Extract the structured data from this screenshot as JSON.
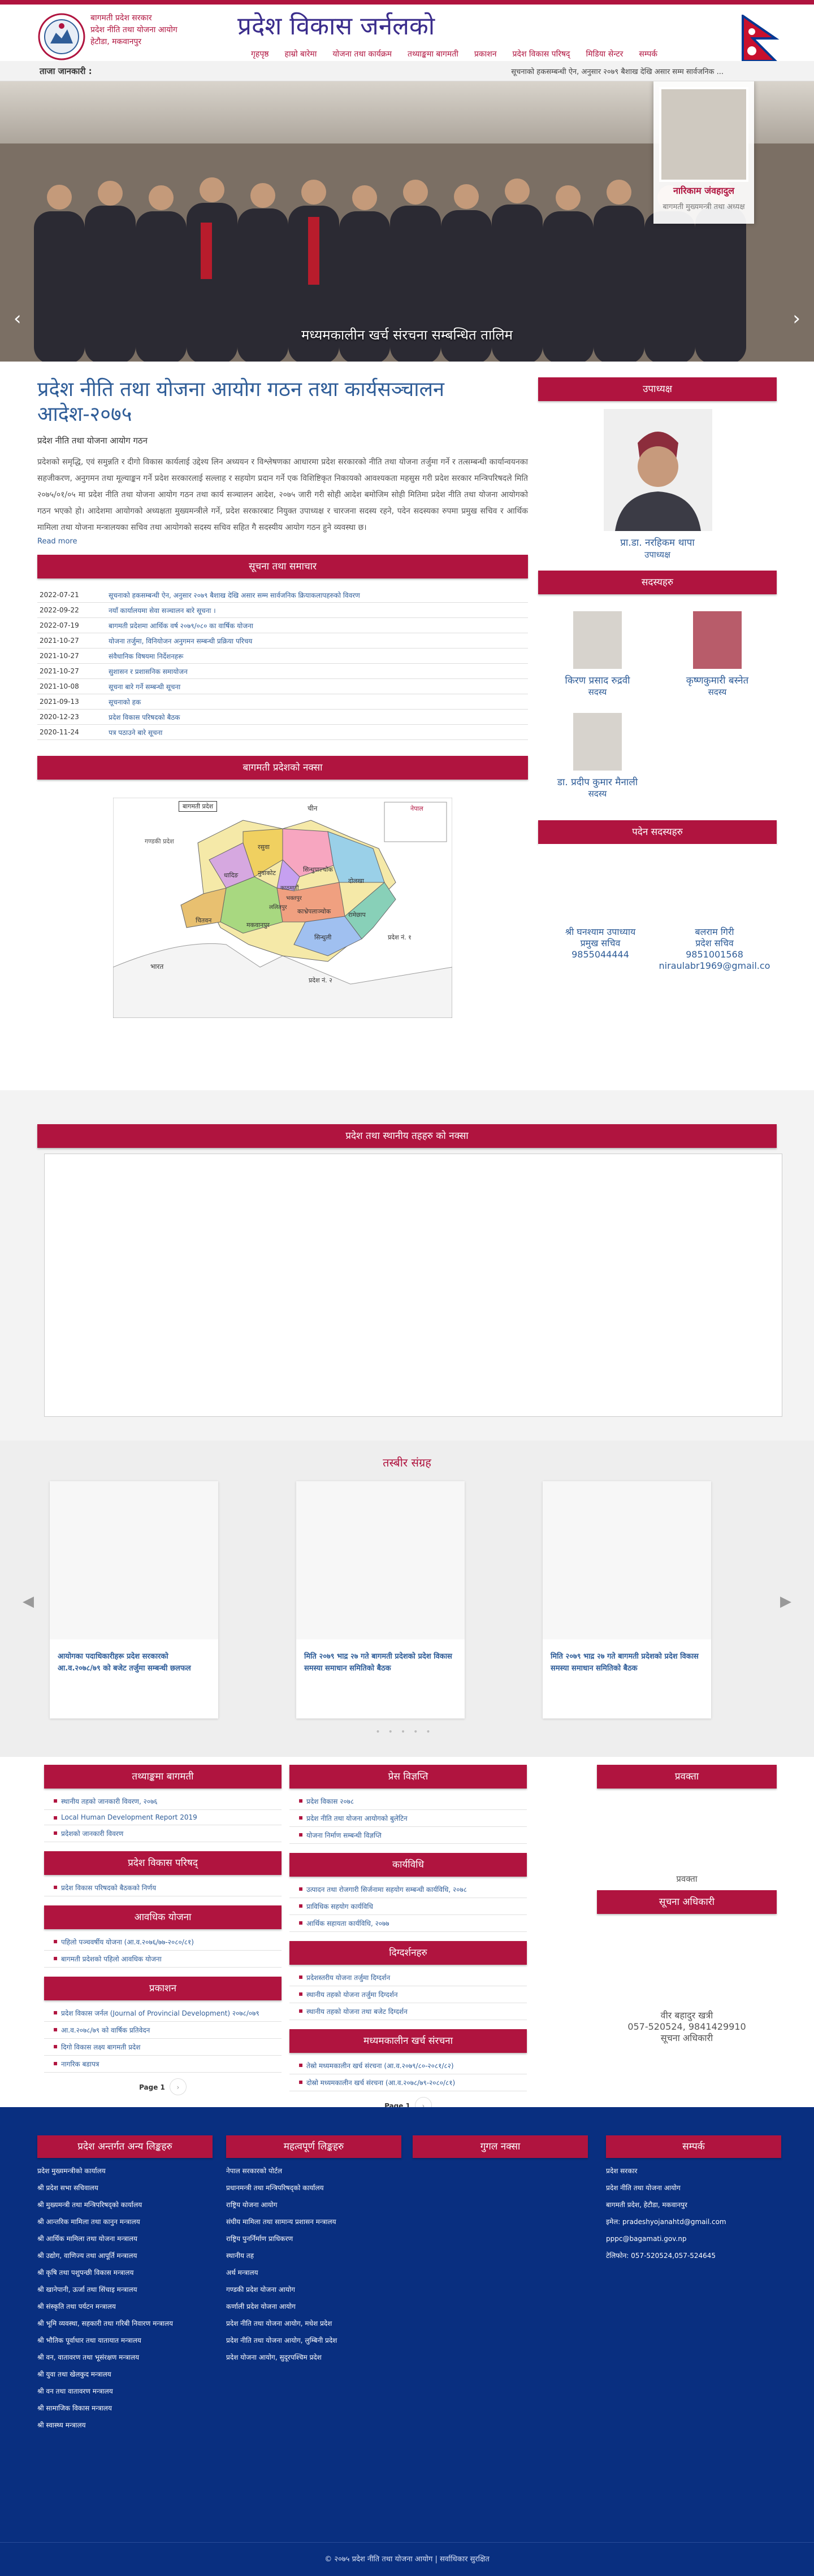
{
  "header": {
    "org_lines": [
      "बागमती प्रदेश सरकार",
      "प्रदेश नीति तथा योजना आयोग",
      "हेटौडा, मकवानपुर"
    ],
    "site_title": "प्रदेश विकास जर्नलको",
    "nav": [
      "गृहपृष्ठ",
      "हाम्रो बारेमा",
      "योजना तथा कार्यक्रम",
      "तथ्याङ्कमा बागमती",
      "प्रकाशन",
      "प्रदेश विकास परिषद्",
      "मिडिया सेन्टर",
      "सम्पर्क"
    ]
  },
  "ticker": {
    "label": "ताजा जानकारी :",
    "text": "सूचनाको हकसम्बन्धी ऐन, अनुसार २०७९ बैशाख देखि असार सम्म सार्वजनिक ..."
  },
  "hero": {
    "caption": "मध्यमकालीन खर्च संरचना सम्बन्धित तालिम",
    "profile_name": "नारिकाम जंवहादुल",
    "profile_role": "बागमती मुख्यमन्त्री तथा अध्यक्ष"
  },
  "main": {
    "title": "प्रदेश नीति तथा योजना आयोग गठन तथा कार्यसञ्चालन आदेश-२०७५",
    "subtitle": "प्रदेश नीति तथा योजना आयोग गठन",
    "body": "प्रदेशको समृद्धि, एवं समुन्नति र दीगो विकास कार्यलाई उद्देश्य लिन अध्ययन र विश्लेषणका आधारमा प्रदेश सरकारको नीति तथा योजना तर्जुमा गर्ने र तत्सम्बन्धी कार्यान्वयनका सहजीकरण, अनुगमन तथा मूल्याङ्कन गर्ने प्रदेश सरकारलाई सल्लाह र सहयोग प्रदान गर्ने एक विशिष्टिकृत निकायको आवश्यकता महसुस गरी प्रदेश सरकार मन्त्रिपरिषदले मिति २०७५/०१/०५ मा प्रदेश नीति तथा योजना आयोग गठन तथा कार्य सञ्चालन आदेश, २०७५ जारी गरी सोही आदेश बमोजिम सोही मितिमा प्रदेश नीति तथा योजना आयोगको गठन भएको हो। आदेशमा आयोगको अध्यक्षता मुख्यमन्त्रीले गर्ने, प्रदेश सरकारबाट नियुक्त उपाध्यक्ष र चारजना सदस्य रहने, पदेन सदस्यका रुपमा प्रमुख सचिव र आर्थिक मामिला तथा योजना मन्त्रालयका सचिव तथा आयोगको सदस्य सचिव सहित गै सदस्यीय आयोग गठन हुने व्यवस्था छ।",
    "more": "Read more",
    "news_title": "सूचना तथा समाचार",
    "news": [
      {
        "d": "2022-07-21",
        "t": "सूचनाको हकसम्बन्धी ऐन, अनुसार २०७९ बैशाख देखि असार सम्म सार्वजनिक क्रियाकलापहरुको विवरण"
      },
      {
        "d": "2022-09-22",
        "t": "नयाँ कार्यालयमा सेवा सञ्चालन बारे सूचना ।"
      },
      {
        "d": "2022-07-19",
        "t": "बागमती प्रदेशमा आर्थिक वर्ष २०७९/०८० का वार्षिक योजना"
      },
      {
        "d": "2021-10-27",
        "t": "योजना तर्जुमा, विनियोजन अनुगमन सम्बन्धी प्रक्रिया परिचय"
      },
      {
        "d": "2021-10-27",
        "t": "संवैधानिक विषयमा निर्देशनहरू"
      },
      {
        "d": "2021-10-27",
        "t": "सुशासन र प्रशासनिक समायोजन"
      },
      {
        "d": "2021-10-08",
        "t": "सूचना बारे गर्ने सम्बन्धी सूचना"
      },
      {
        "d": "2021-09-13",
        "t": "सूचनाको हक"
      },
      {
        "d": "2020-12-23",
        "t": "प्रदेश विकास परिषदको बैठक"
      },
      {
        "d": "2020-11-24",
        "t": "पत्र पठाउने बारे सूचना"
      }
    ],
    "map_title": "बागमती प्रदेशको नक्सा",
    "map_labels": [
      "बागमती प्रदेश",
      "चीन",
      "नेपाल",
      "भारत",
      "गण्डकी प्रदेश",
      "रसुवा",
      "धादिङ",
      "नुवाकोट",
      "सिन्धुपाल्चोक",
      "काठमाडौं",
      "दोलखा",
      "भक्तपुर",
      "ललितपुर",
      "काभ्रेपलाञ्चोक",
      "रामेछाप",
      "सिन्धुली",
      "मकवानपुर",
      "चितवन",
      "प्रदेश नं. १",
      "प्रदेश नं. २"
    ]
  },
  "right": {
    "vice_title": "उपाध्यक्ष",
    "vice_name": "प्रा.डा. नरहिकम थापा",
    "vice_role": "उपाध्यक्ष",
    "members_title": "सदस्यहरु",
    "members": [
      {
        "name": "किरण प्रसाद रुद्रवी",
        "role": "सदस्य"
      },
      {
        "name": "कृष्णकुमारी बस्नेत",
        "role": "सदस्य"
      },
      {
        "name": "डा. प्रदीप कुमार मैनाली",
        "role": "सदस्य"
      }
    ],
    "staff_title": "पदेन सदस्यहरु",
    "staff": [
      {
        "name": "श्री घनश्याम उपाध्याय",
        "role": "प्रमुख सचिव",
        "phone": "9855044444"
      },
      {
        "name": "बलराम गिरी",
        "role": "प्रदेश सचिव",
        "phone": "9851001568",
        "email": "niraulabr1969@gmail.co"
      }
    ]
  },
  "localmap": {
    "title": "प्रदेश तथा स्थानीय तहहरु को नक्सा"
  },
  "gallery": {
    "title": "तस्बीर संग्रह",
    "items": [
      "आयोगका पदाधिकारीहरू प्रदेश सरकारको आ.व.२०७८/७९ को बजेट तर्जुमा सम्बन्धी छलफल",
      "मिति २०७९ भाद्र २७ गते बागमती प्रदेशको प्रदेश विकास समस्या समाधान समितिको बैठक",
      "मिति २०७९ भाद्र २७ गते बागमती प्रदेशको प्रदेश विकास समस्या समाधान समितिको बैठक"
    ]
  },
  "info": {
    "c1": [
      {
        "title": "तथ्याङ्कमा बागमती",
        "items": [
          "स्थानीय तहको जानकारी विवरण, २०७६",
          "Local Human Development Report 2019",
          "प्रदेशको जानकारी विवरण"
        ]
      },
      {
        "title": "प्रदेश विकास परिषद्",
        "items": [
          "प्रदेश विकास परिषदको बैठकको निर्णय"
        ]
      },
      {
        "title": "आवधिक योजना",
        "items": [
          "पहिलो पञ्चवर्षीय योजना (आ.व.२०७६/७७-२०८०/८१)",
          "बागमती प्रदेशको पहिलो आवधिक योजना"
        ]
      },
      {
        "title": "प्रकाशन",
        "items": [
          "प्रदेश विकास जर्नल (Journal of Provincial Development) २०७८/०७९",
          "आ.व.२०७८/७९ को वार्षिक प्रतिवेदन",
          "दिगो विकास लक्ष्य बागमती प्रदेश",
          "नागरिक बडापत्र"
        ]
      }
    ],
    "c2": [
      {
        "title": "प्रेस विज्ञप्ति",
        "items": [
          "प्रदेश विकास २०७८",
          "प्रदेश नीति तथा योजना आयोगको बुलेटिन",
          "योजना निर्माण सम्बन्धी विज्ञप्ति"
        ]
      },
      {
        "title": "कार्यविधि",
        "items": [
          "उत्पादन तथा रोजगारी सिर्जनामा सहयोग सम्बन्धी कार्यविधि, २०७८",
          "प्राविधिक सहयोग कार्यविधि",
          "आर्थिक सहायता कार्यविधि, २०७७"
        ]
      },
      {
        "title": "दिग्दर्शनहरु",
        "items": [
          "प्रदेशस्तरीय योजना तर्जुमा दिग्दर्शन",
          "स्थानीय तहको योजना तर्जुमा दिग्दर्शन",
          "स्थानीय तहको योजना तथा बजेट दिग्दर्शन"
        ]
      },
      {
        "title": "मध्यमकालीन खर्च संरचना",
        "items": [
          "तेस्रो मध्यमकालीन खर्च संरचना (आ.व.२०७९/८०-२०८१/८२)",
          "दोस्रो मध्यमकालीन खर्च संरचना (आ.व.२०७८/७९-२०८०/८१)"
        ]
      }
    ],
    "page_label": "Page 1",
    "c3_title1": "प्रवक्ता",
    "c3_title2": "सूचना अधिकारी",
    "spokesperson": "प्रवक्ता",
    "info_officer": {
      "name": "वीर बहादुर खत्री",
      "phone": "057-520524, 9841429910",
      "role": "सूचना अधिकारी"
    }
  },
  "footer": {
    "c1_title": "प्रदेश अन्तर्गत अन्य लिङ्कहरु",
    "c1": [
      "प्रदेश मुख्यमन्त्रीको कार्यालय",
      "श्री प्रदेश सभा सचिवालय",
      "श्री मुख्यमन्त्री तथा मन्त्रिपरिषद्को कार्यालय",
      "श्री आन्तरिक मामिला तथा कानुन मन्त्रालय",
      "श्री आर्थिक मामिला तथा योजना मन्त्रालय",
      "श्री उद्योग, वाणिज्य तथा आपूर्ति मन्त्रालय",
      "श्री कृषि तथा पशुपन्छी विकास मन्त्रालय",
      "श्री खानेपानी, ऊर्जा तथा सिंचाइ मन्त्रालय",
      "श्री संस्कृति तथा पर्यटन मन्त्रालय",
      "श्री भूमि व्यवस्था, सहकारी तथा गरिबी निवारण मन्त्रालय",
      "श्री भौतिक पूर्वाधार तथा यातायात मन्त्रालय",
      "श्री वन, वातावरण तथा भूसंरक्षण मन्त्रालय",
      "श्री युवा तथा खेलकुद मन्त्रालय",
      "श्री वन तथा वातावरण मन्त्रालय",
      "श्री सामाजिक विकास मन्त्रालय",
      "श्री स्वास्थ्य मन्त्रालय"
    ],
    "c2_title": "महत्वपूर्ण लिङ्कहरु",
    "c2": [
      "नेपाल सरकारको पोर्टल",
      "प्रधानमन्त्री तथा मन्त्रिपरिषद्को कार्यालय",
      "राष्ट्रिय योजना आयोग",
      "संघीय मामिला तथा सामान्य प्रशासन मन्त्रालय",
      "राष्ट्रिय पुनर्निर्माण प्राधिकरण",
      "स्थानीय तह",
      "अर्थ मन्त्रालय",
      "गण्डकी प्रदेश योजना आयोग",
      "कर्णाली प्रदेश योजना आयोग",
      "प्रदेश नीति तथा योजना आयोग, मधेश प्रदेश",
      "प्रदेश नीति तथा योजना आयोग, लुम्बिनी प्रदेश",
      "प्रदेश योजना आयोग, सुदूरपश्चिम प्रदेश"
    ],
    "c3_title": "गुगल नक्सा",
    "c4_title": "सम्पर्क",
    "contact": [
      "प्रदेश सरकार",
      "प्रदेश नीति तथा योजना आयोग",
      "बागमती प्रदेश, हेटौडा, मकवानपुर",
      "इमेल: pradeshyojanahtd@gmail.com",
      "pppc@bagamati.gov.np",
      "टेलिफोन: 057-520524,057-524645"
    ],
    "copy": "© २०७५ प्रदेश नीति तथा योजना आयोग | सर्वाधिकार सुरक्षित"
  },
  "colors": {
    "maroon": "#b0143f",
    "navy": "#092f80",
    "link": "#2f5d98"
  }
}
